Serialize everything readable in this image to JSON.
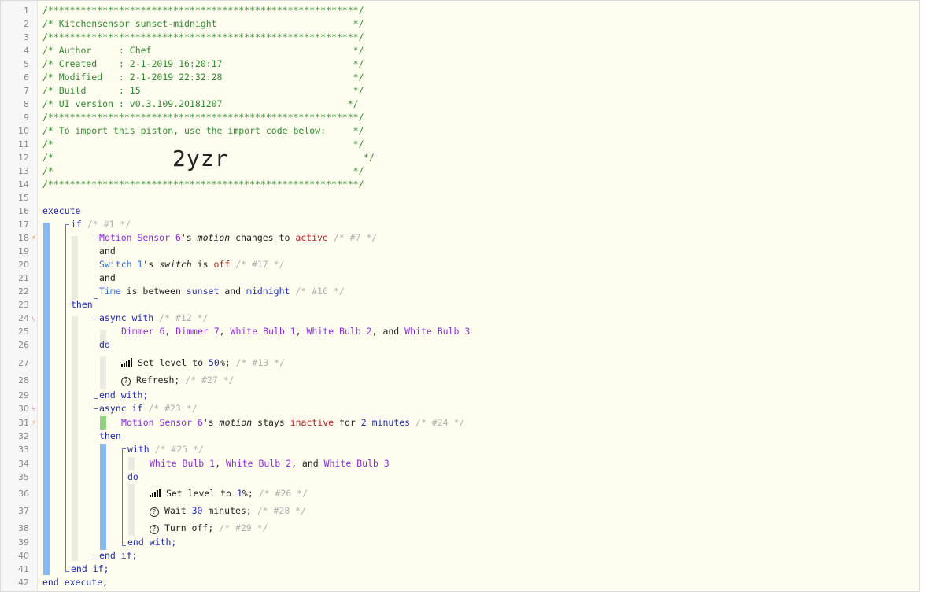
{
  "header": {
    "border_line": "/*********************************************************/",
    "title": "/* Kitchensensor sunset-midnight                         */",
    "author": "/* Author     : Chef                                     */",
    "created": "/* Created    : 2-1-2019 16:20:17                        */",
    "modified": "/* Modified   : 2-1-2019 22:32:28                        */",
    "build": "/* Build      : 15                                       */",
    "ui_version": "/* UI version : v0.3.109.20181207                       */",
    "import_note": "/* To import this piston, use the import code below:     */",
    "empty_comment": "/*                                                       */",
    "comment_open": "/*",
    "comment_close": "*/",
    "import_code": "2yzr"
  },
  "keywords": {
    "execute": "execute",
    "if": "if",
    "and": "and",
    "then": "then",
    "async_with": "async with",
    "do": "do",
    "end_with": "end with;",
    "async_if": "async if",
    "with": "with",
    "end_if": "end if;",
    "end_execute": "end execute;"
  },
  "comments": {
    "c1": "/* #1 */",
    "c7": "/* #7 */",
    "c17": "/* #17 */",
    "c16": "/* #16 */",
    "c12": "/* #12 */",
    "c13": "/* #13 */",
    "c27": "/* #27 */",
    "c23": "/* #23 */",
    "c24": "/* #24 */",
    "c25": "/* #25 */",
    "c26": "/* #26 */",
    "c28": "/* #28 */",
    "c29": "/* #29 */"
  },
  "conditions": {
    "motion_sensor_6": "Motion Sensor 6",
    "poss": "'s",
    "motion": "motion",
    "changes_to": "changes to",
    "active": "active",
    "switch_1": "Switch 1",
    "switch": "switch",
    "is": "is",
    "off": "off",
    "time": "Time",
    "is_between": "is between",
    "sunset": "sunset",
    "and_word": "and",
    "midnight": "midnight",
    "stays": "stays",
    "inactive": "inactive",
    "for_word": "for",
    "two": "2",
    "minutes_word": "minutes"
  },
  "devices": {
    "dimmer_6": "Dimmer 6",
    "dimmer_7": "Dimmer 7",
    "white_bulb_1": "White Bulb 1",
    "white_bulb_2": "White Bulb 2",
    "white_bulb_3": "White Bulb 3",
    "comma": ",",
    "comma_and": ", and"
  },
  "statements": {
    "set_level_to": "Set level to",
    "level_50": "50",
    "level_1": "1",
    "pct_semi": "%;",
    "refresh": "Refresh;",
    "wait": "Wait",
    "wait_30": "30",
    "minutes_semi": "minutes;",
    "turn_off": "Turn off;"
  },
  "line_numbers": [
    "1",
    "2",
    "3",
    "4",
    "5",
    "6",
    "7",
    "8",
    "9",
    "10",
    "11",
    "12",
    "13",
    "14",
    "15",
    "16",
    "17",
    "18",
    "19",
    "20",
    "21",
    "22",
    "23",
    "24",
    "25",
    "26",
    "27",
    "28",
    "29",
    "30",
    "31",
    "32",
    "33",
    "34",
    "35",
    "36",
    "37",
    "38",
    "39",
    "40",
    "41",
    "42"
  ],
  "gutter_icons": {
    "bolt": "⚡",
    "fork": "⑂"
  },
  "colors": {
    "comment": "#2e8b2e",
    "keyword": "#1f2bb8",
    "device": "#8a2be2",
    "value": "#b22222",
    "block_bar": "#85b9f0",
    "condition_bar": "#8ed27d",
    "editor_bg": "#fefdf0"
  }
}
